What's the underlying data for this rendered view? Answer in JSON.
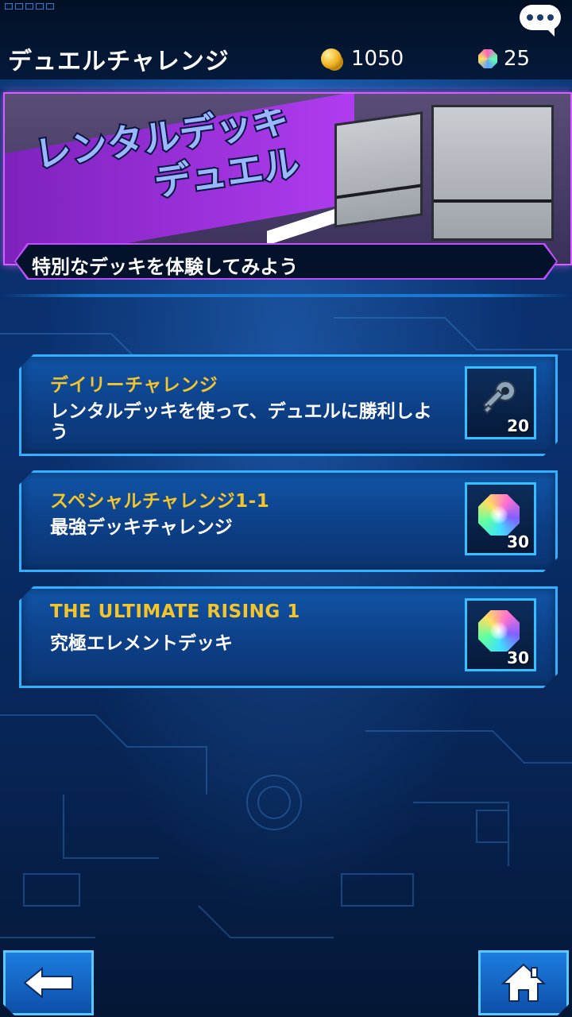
{
  "header": {
    "title": "デュエルチャレンジ",
    "gold": "1050",
    "gems": "25",
    "chat_icon": "chat-bubble-icon"
  },
  "banner": {
    "logo_line1": "レンタルデッキ",
    "logo_line2": "デュエル",
    "caption": "特別なデッキを体験してみよう"
  },
  "challenges": [
    {
      "title": "デイリーチャレンジ",
      "description": "レンタルデッキを使って、デュエルに勝利しよう",
      "reward_icon": "key-icon",
      "reward_count": "20"
    },
    {
      "title": "スペシャルチャレンジ1-1",
      "description": "最強デッキチャレンジ",
      "reward_icon": "gem-icon",
      "reward_count": "30"
    },
    {
      "title": "THE ULTIMATE RISING 1",
      "description": "究極エレメントデッキ",
      "reward_icon": "gem-icon",
      "reward_count": "30"
    }
  ],
  "nav": {
    "back_icon": "arrow-left-icon",
    "home_icon": "home-icon"
  },
  "colors": {
    "accent_blue": "#30b0ff",
    "title_gold": "#f3c52a",
    "banner_purple": "#b03cf0"
  }
}
